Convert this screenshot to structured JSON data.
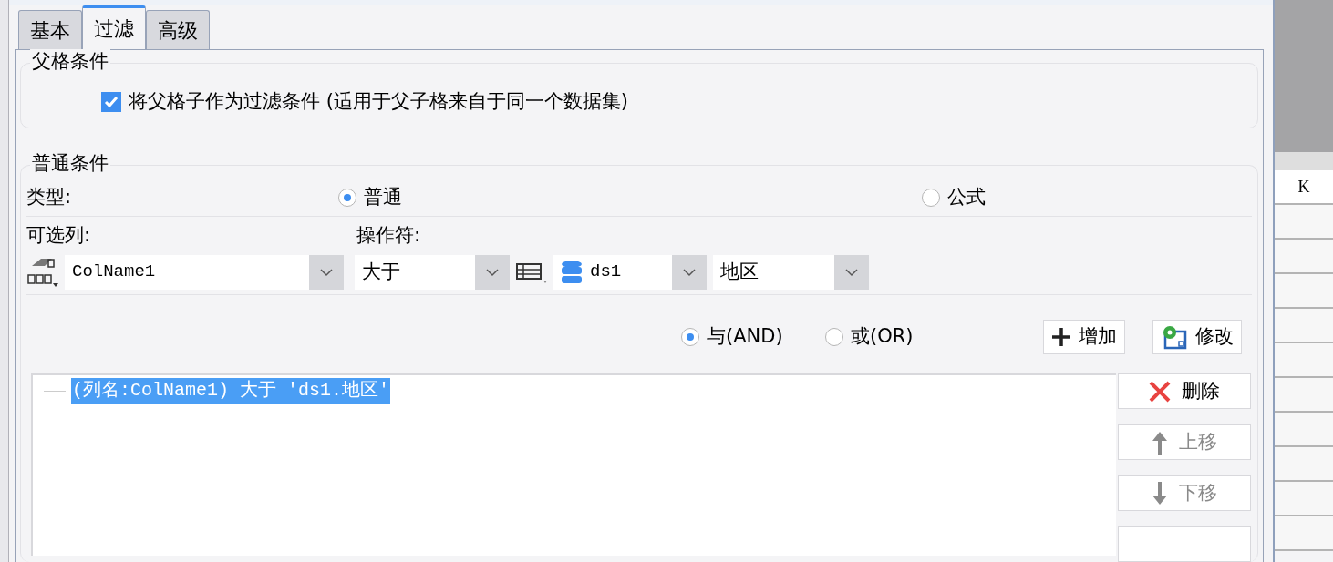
{
  "tabs": [
    {
      "label": "基本",
      "selected": false
    },
    {
      "label": "过滤",
      "selected": true
    },
    {
      "label": "高级",
      "selected": false
    }
  ],
  "parent_group": {
    "legend": "父格条件",
    "checkbox": {
      "label": "将父格子作为过滤条件 (适用于父子格来自于同一个数据集)",
      "checked": true
    }
  },
  "normal_group": {
    "legend": "普通条件",
    "type_label": "类型:",
    "type_options": [
      {
        "label": "普通",
        "selected": true
      },
      {
        "label": "公式",
        "selected": false
      }
    ],
    "column_label": "可选列:",
    "operator_label": "操作符:",
    "column_select": {
      "value": "ColName1"
    },
    "operator_select": {
      "value": "大于"
    },
    "dataset_select": {
      "value": "ds1"
    },
    "field_select": {
      "value": "地区"
    },
    "logic_options": [
      {
        "label": "与(AND)",
        "selected": true
      },
      {
        "label": "或(OR)",
        "selected": false
      }
    ],
    "buttons": [
      {
        "label": "增加",
        "kind": "add"
      },
      {
        "label": "修改",
        "kind": "edit"
      }
    ],
    "conditions": [
      {
        "text": "(列名:ColName1) 大于 'ds1.地区'",
        "selected": true
      }
    ],
    "side_buttons": [
      {
        "label": "删除",
        "kind": "delete",
        "disabled": false
      },
      {
        "label": "上移",
        "kind": "up",
        "disabled": true
      },
      {
        "label": "下移",
        "kind": "down",
        "disabled": true
      }
    ]
  },
  "sheet": {
    "column_header": "K"
  }
}
